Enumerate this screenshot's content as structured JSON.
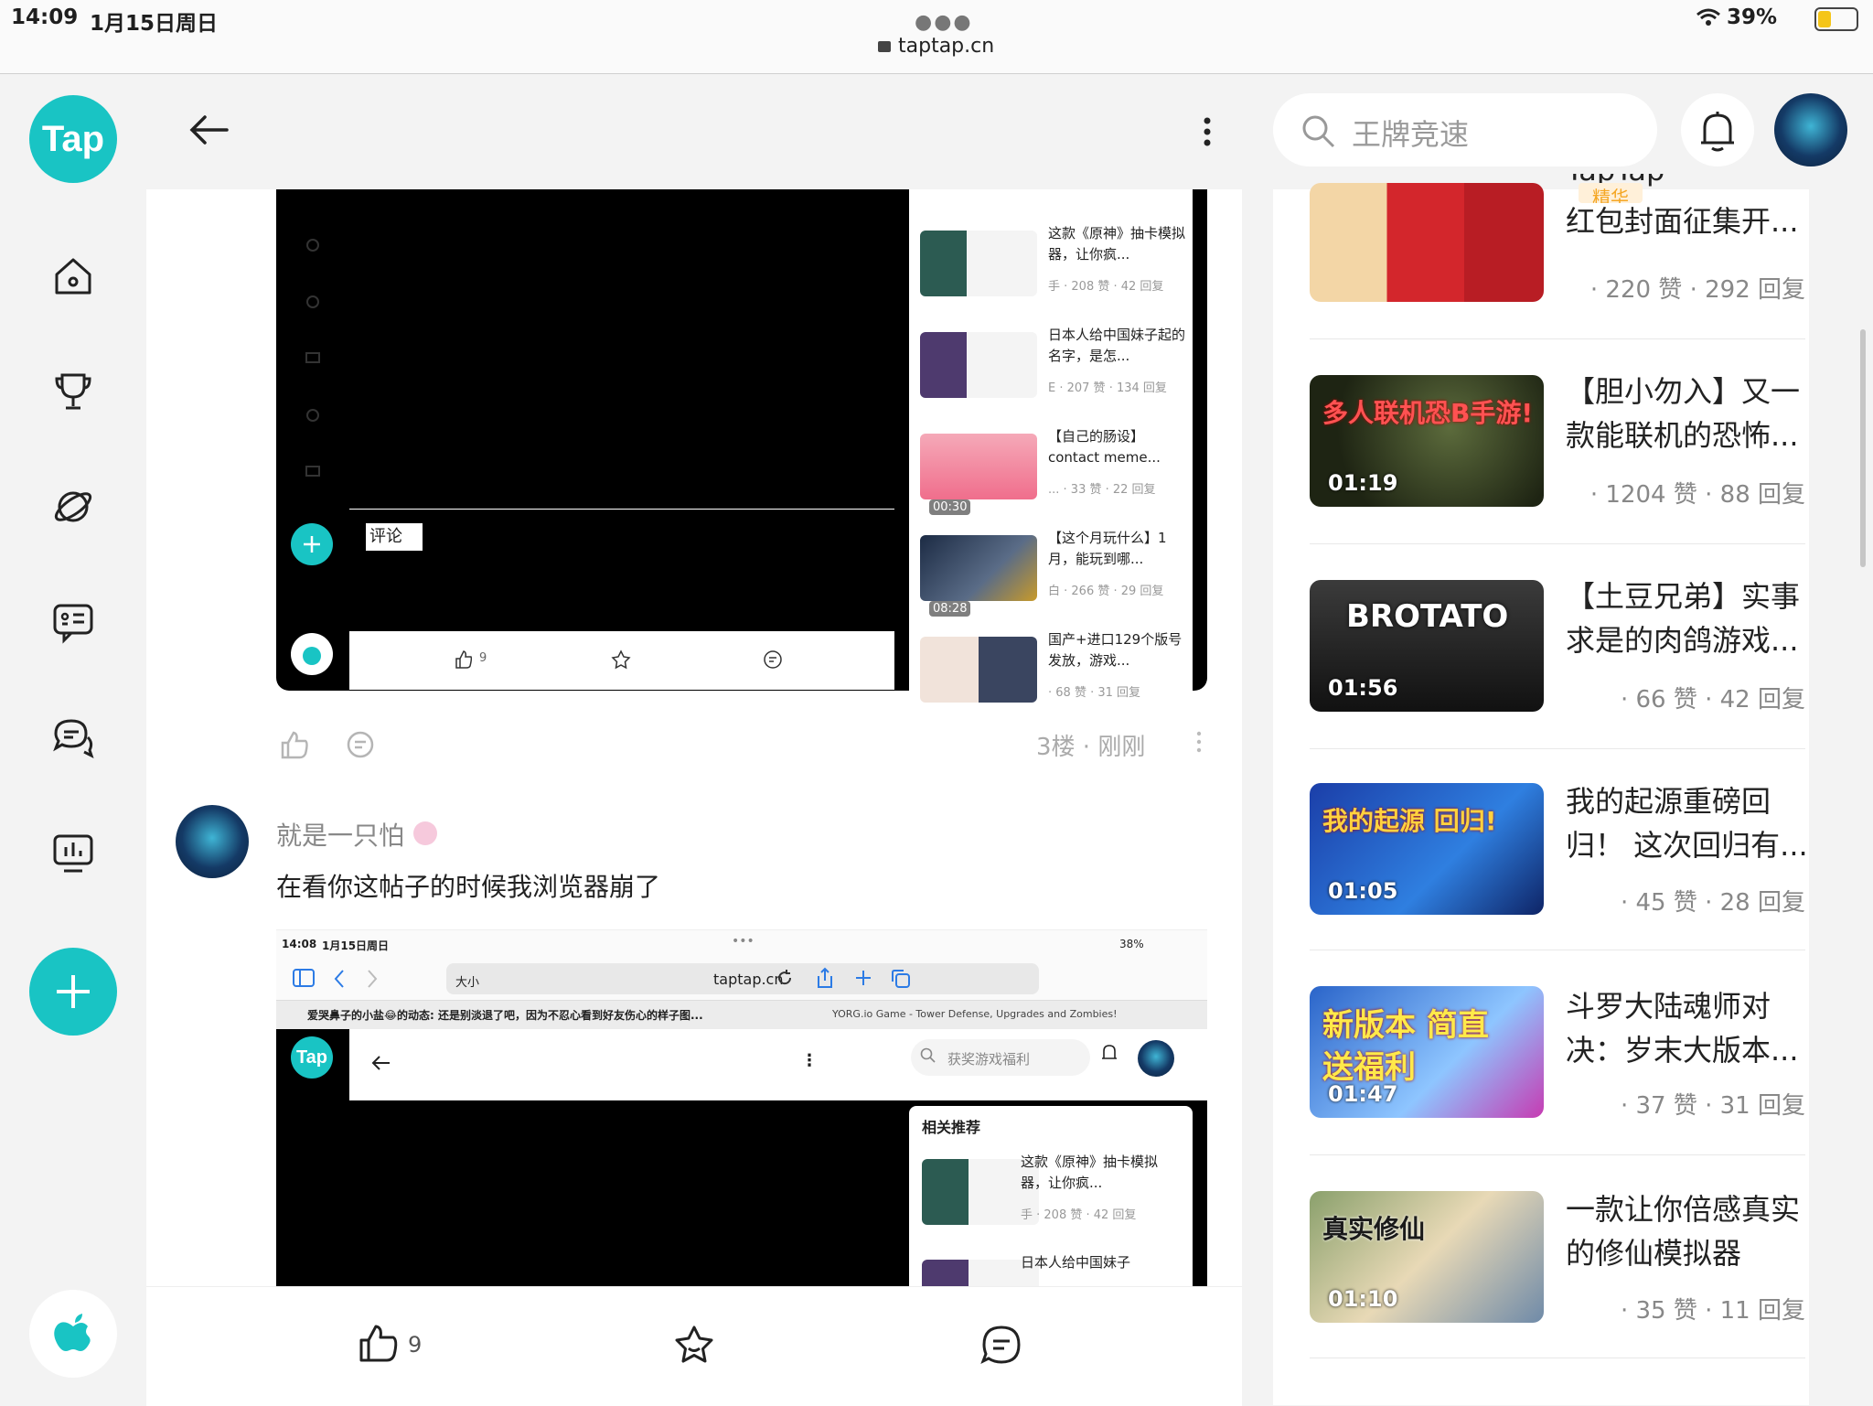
{
  "status": {
    "time": "14:09",
    "date": "1月15日周日",
    "url": "taptap.cn",
    "battery": "39%"
  },
  "sidebar": {
    "logo": "Tap",
    "icons": [
      "home-icon",
      "trophy-icon",
      "planet-icon",
      "chat-card-icon",
      "forum-icon",
      "chart-icon"
    ]
  },
  "search": {
    "placeholder": "王牌竞速"
  },
  "post": {
    "shot1": {
      "comment_label": "评论",
      "like_count": "9",
      "recs": [
        {
          "title": "这款《原神》抽卡模拟器，让你疯...",
          "meta": "手 · 208 赞 · 42 回复",
          "duration": ""
        },
        {
          "title": "日本人给中国妹子起的名字，是怎...",
          "meta": "E · 207 赞 · 134 回复",
          "duration": ""
        },
        {
          "title": "【自己的肠设】contact meme...",
          "meta": "... · 33 赞 · 22 回复",
          "duration": "00:30"
        },
        {
          "title": "【这个月玩什么】1月，能玩到哪...",
          "meta": "白 · 266 赞 · 29 回复",
          "duration": "08:28"
        },
        {
          "title": "国产+进口129个版号发放，游戏...",
          "meta": "· 68 赞 · 31 回复",
          "duration": ""
        }
      ]
    },
    "floor": "3楼 · 刚刚",
    "comment": {
      "user": "就是一只怕",
      "text": "在看你这帖子的时候我浏览器崩了"
    },
    "shot2": {
      "time": "14:08",
      "date": "1月15日周日",
      "battery": "38%",
      "addr_left": "大小",
      "url": "taptap.cn",
      "tab1": "爱哭鼻子的小盐😂的动态: 还是别淡退了吧，因为不忍心看到好友伤心的样子图...",
      "tab2": "YORG.io Game - Tower Defense, Upgrades and Zombies!",
      "logo": "Tap",
      "search": "获奖游戏福利",
      "rec_heading": "相关推荐",
      "recs": [
        {
          "title": "这款《原神》抽卡模拟器，让你疯...",
          "meta": "手 · 208 赞 · 42 回复"
        },
        {
          "title": "日本人给中国妹子",
          "meta": ""
        }
      ]
    }
  },
  "bottom_bar": {
    "like_count": "9"
  },
  "videos": [
    {
      "title_lines": [
        "TapTap",
        "红包封面征集开..."
      ],
      "meta": "· 220 赞 · 292 回复",
      "duration": "",
      "overlay": "",
      "tag": "精华"
    },
    {
      "title_lines": [
        "【胆小勿入】又一",
        "款能联机的恐怖..."
      ],
      "meta": "· 1204 赞 · 88 回复",
      "duration": "01:19",
      "overlay": "多人联机恐B手游!"
    },
    {
      "title_lines": [
        "【土豆兄弟】实事",
        "求是的肉鸽游戏..."
      ],
      "meta": "· 66 赞 · 42 回复",
      "duration": "01:56",
      "overlay": "BROTATO"
    },
    {
      "title_lines": [
        "我的起源重磅回",
        "归！ 这次回归有..."
      ],
      "meta": "· 45 赞 · 28 回复",
      "duration": "01:05",
      "overlay": "我的起源 回归!"
    },
    {
      "title_lines": [
        "斗罗大陆魂师对",
        "决：岁末大版本..."
      ],
      "meta": "· 37 赞 · 31 回复",
      "duration": "01:47",
      "overlay": "新版本 简直送福利"
    },
    {
      "title_lines": [
        "一款让你倍感真实",
        "的修仙模拟器"
      ],
      "meta": "· 35 赞 · 11 回复",
      "duration": "01:10",
      "overlay": "真实修仙"
    }
  ],
  "colors": {
    "accent": "#19c4c4",
    "background": "#f3f3f3"
  }
}
